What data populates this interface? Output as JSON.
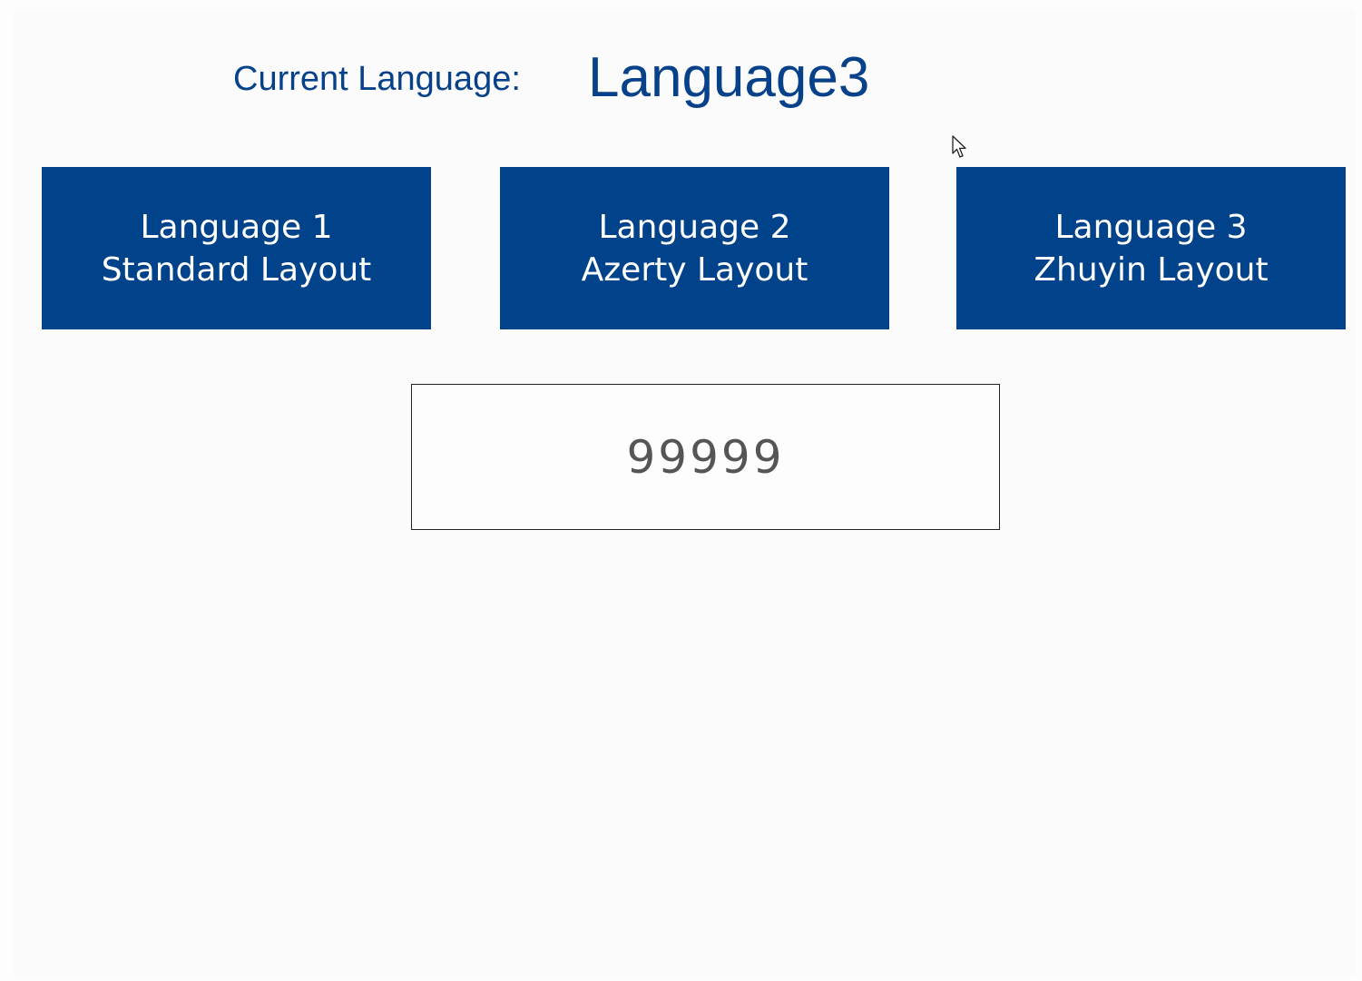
{
  "header": {
    "current_language_label": "Current Language:",
    "current_language_value": "Language3"
  },
  "buttons": [
    {
      "line1": "Language 1",
      "line2": "Standard Layout"
    },
    {
      "line1": "Language 2",
      "line2": "Azerty Layout"
    },
    {
      "line1": "Language 3",
      "line2": "Zhuyin Layout"
    }
  ],
  "number_field": {
    "value": "99999"
  },
  "colors": {
    "accent": "#01438a",
    "label_text": "#07418a",
    "background": "#fbfbfb"
  },
  "icons": {
    "cursor": "mouse-pointer-icon"
  }
}
